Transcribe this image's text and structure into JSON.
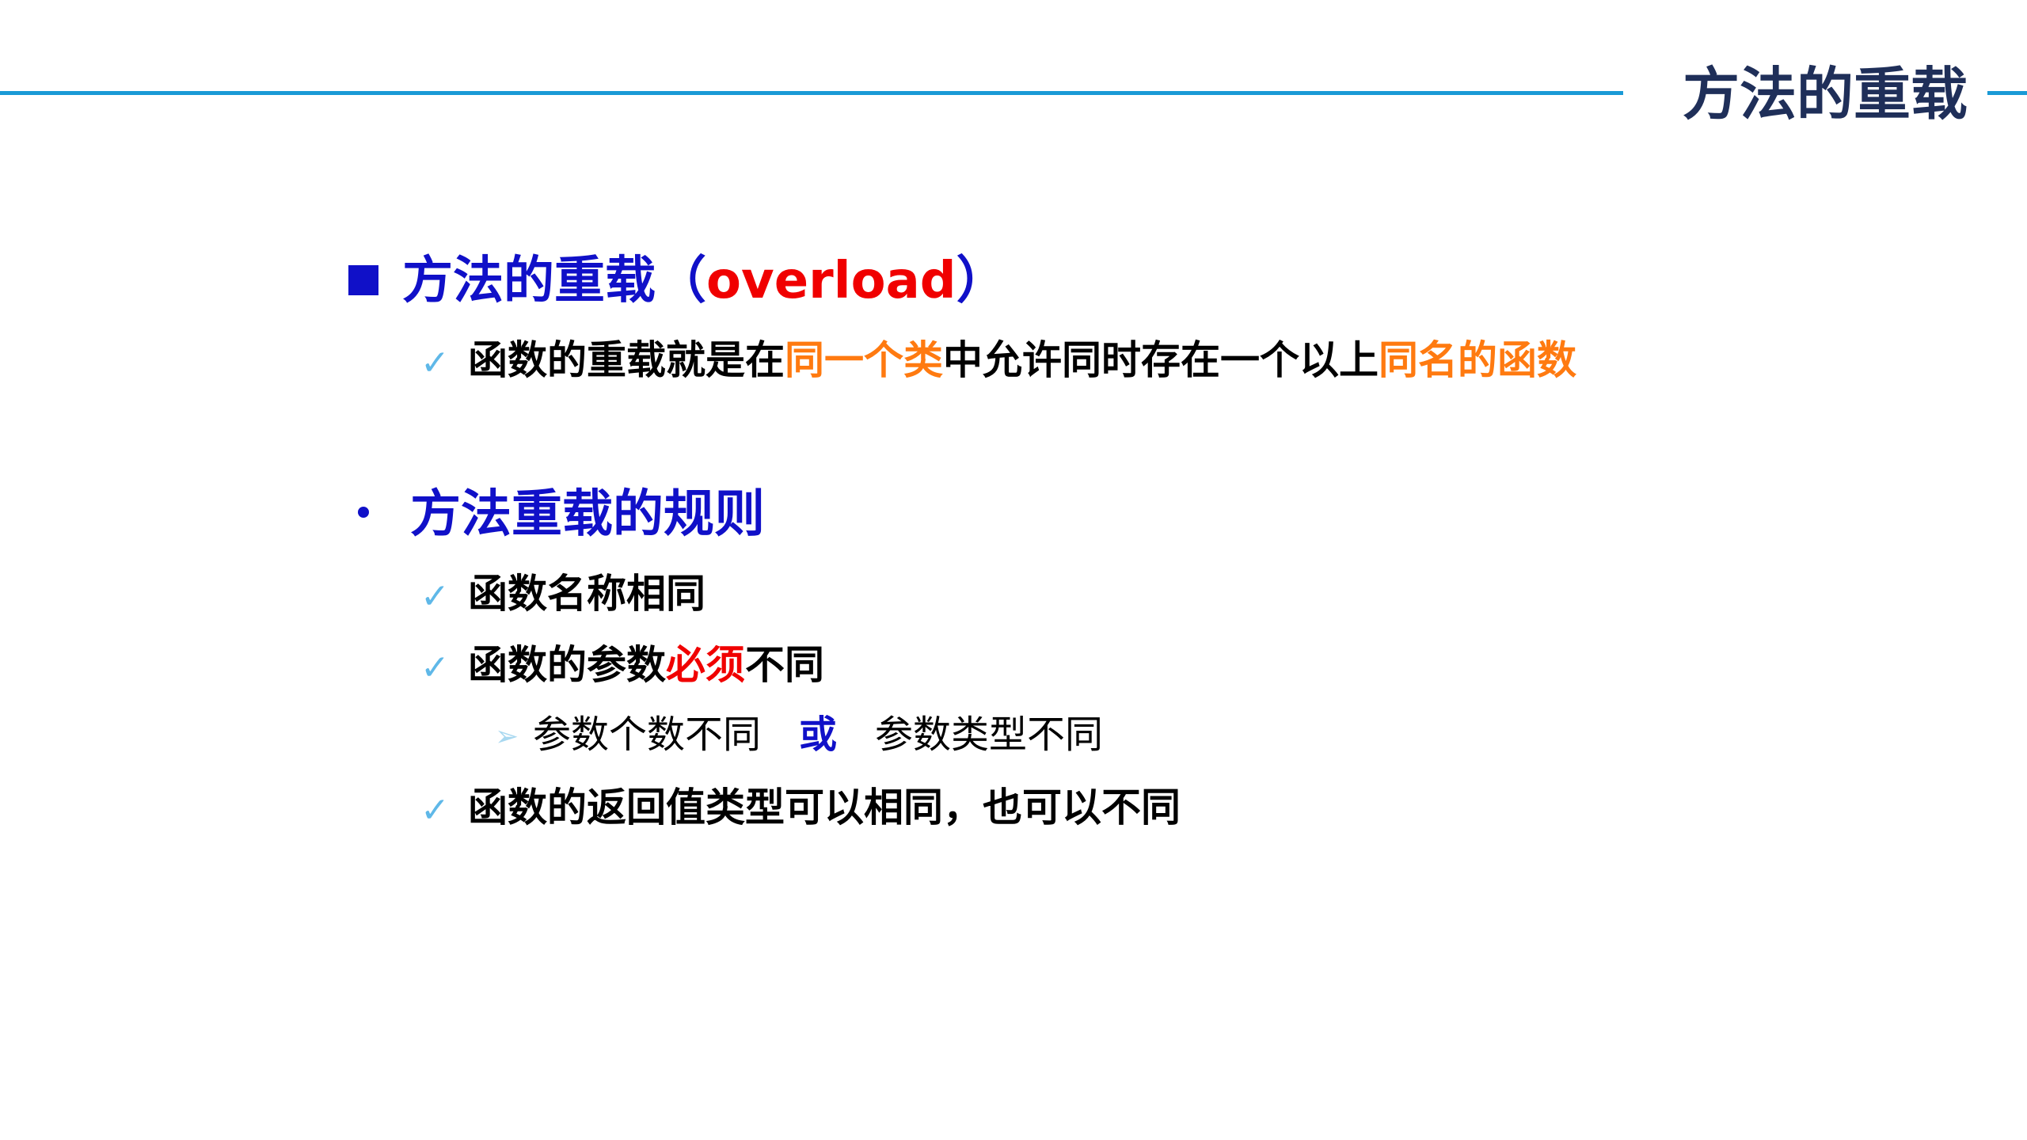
{
  "header": {
    "title": "方法的重载"
  },
  "section1": {
    "heading_main": "方法的重载（",
    "heading_keyword": "overload",
    "heading_close": "）",
    "point1": {
      "part1": "函数的重载就是在",
      "highlight1": "同一个类",
      "part2": "中允许同时存在一个以上",
      "highlight2": "同名的函数"
    }
  },
  "section2": {
    "heading": "方法重载的规则",
    "rule1": "函数名称相同",
    "rule2": {
      "part1": "函数的参数",
      "highlight": "必须",
      "part2": "不同"
    },
    "sub_rule": {
      "left": "参数个数不同",
      "connector": "或",
      "right": "参数类型不同"
    },
    "rule3": "函数的返回值类型可以相同，也可以不同"
  },
  "colors": {
    "title_navy": "#1f2f59",
    "rule_line": "#1a9ad6",
    "heading_blue": "#1010c8",
    "highlight_orange": "#ff7a10",
    "highlight_red": "#f00000",
    "check_blue": "#5fb8e8"
  },
  "icons": {
    "heading_bullet": "square-bullet-icon",
    "section_bullet": "dot-bullet-icon",
    "item_bullet": "check-icon",
    "sub_bullet": "arrow-icon"
  }
}
